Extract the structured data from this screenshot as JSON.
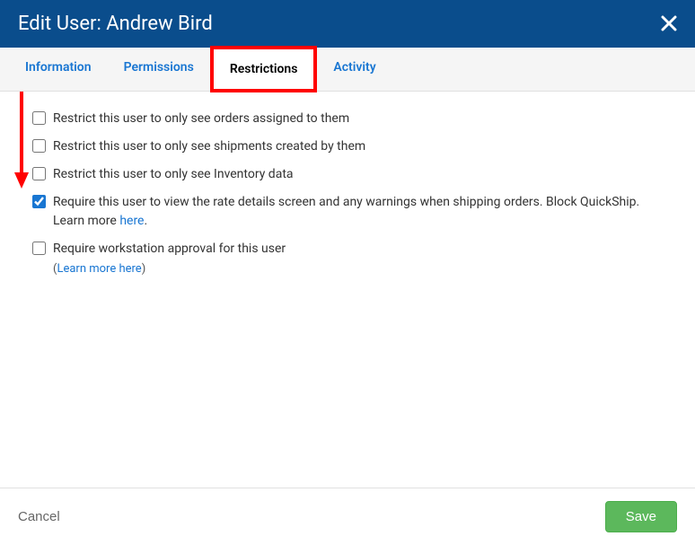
{
  "header": {
    "title": "Edit User: Andrew Bird"
  },
  "tabs": {
    "information": "Information",
    "permissions": "Permissions",
    "restrictions": "Restrictions",
    "activity": "Activity",
    "active": "restrictions"
  },
  "restrictions": [
    {
      "label": "Restrict this user to only see orders assigned to them",
      "checked": false
    },
    {
      "label": "Restrict this user to only see shipments created by them",
      "checked": false
    },
    {
      "label": "Restrict this user to only see Inventory data",
      "checked": false
    },
    {
      "label_prefix": "Require this user to view the rate details screen and any warnings when shipping orders. Block QuickShip. Learn more ",
      "link_text": "here",
      "label_suffix": ".",
      "checked": true
    },
    {
      "label": "Require workstation approval for this user",
      "checked": false,
      "sub_prefix": "(",
      "sub_link": "Learn more here",
      "sub_suffix": ")"
    }
  ],
  "footer": {
    "cancel": "Cancel",
    "save": "Save"
  }
}
